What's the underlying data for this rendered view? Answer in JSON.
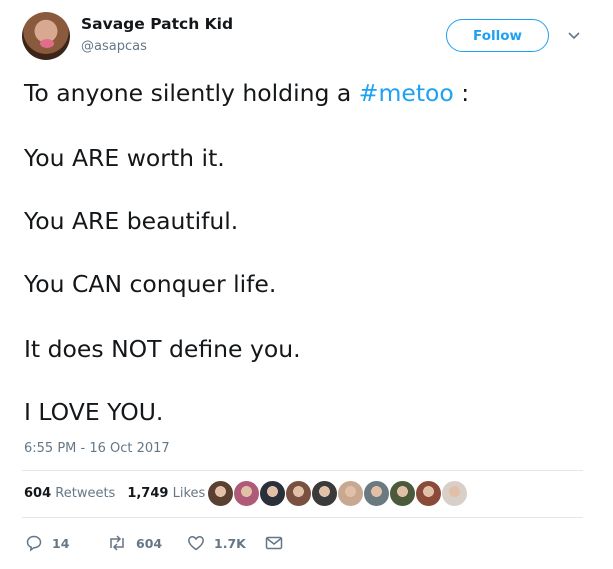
{
  "user": {
    "display_name": "Savage Patch Kid",
    "handle": "@asapcas",
    "avatar_icon": "profile-photo"
  },
  "follow_button": {
    "label": "Follow"
  },
  "tweet": {
    "line1_prefix": "To anyone silently holding a ",
    "line1_hashtag": "#metoo",
    "line1_suffix": " :",
    "lines": [
      "You ARE worth it.",
      "You ARE beautiful.",
      "You CAN conquer life.",
      "It does NOT define you.",
      "I LOVE YOU."
    ],
    "hashtag_color": "#1da1f2"
  },
  "timestamp": "6:55 PM - 16 Oct 2017",
  "stats": {
    "retweets_count": "604",
    "retweets_label": "Retweets",
    "likes_count": "1,749",
    "likes_label": "Likes"
  },
  "actions": {
    "reply_count": "14",
    "retweet_count": "604",
    "like_count": "1.7K"
  },
  "liker_faces": [
    {
      "icon": "liker-avatar-1",
      "color": "#5a4030"
    },
    {
      "icon": "liker-avatar-2",
      "color": "#b05a7a"
    },
    {
      "icon": "liker-avatar-3",
      "color": "#2a2f3a"
    },
    {
      "icon": "liker-avatar-4",
      "color": "#7a5040"
    },
    {
      "icon": "liker-avatar-5",
      "color": "#3a3a3a"
    },
    {
      "icon": "liker-avatar-6",
      "color": "#c8a890"
    },
    {
      "icon": "liker-avatar-7",
      "color": "#6a7a80"
    },
    {
      "icon": "liker-avatar-8",
      "color": "#4a5a3a"
    },
    {
      "icon": "liker-avatar-9",
      "color": "#8a4a3a"
    },
    {
      "icon": "liker-avatar-10",
      "color": "#d8d0c8"
    }
  ],
  "colors": {
    "accent": "#1da1f2",
    "muted": "#657786",
    "text": "#14171a",
    "divider": "#e1e8ed"
  }
}
